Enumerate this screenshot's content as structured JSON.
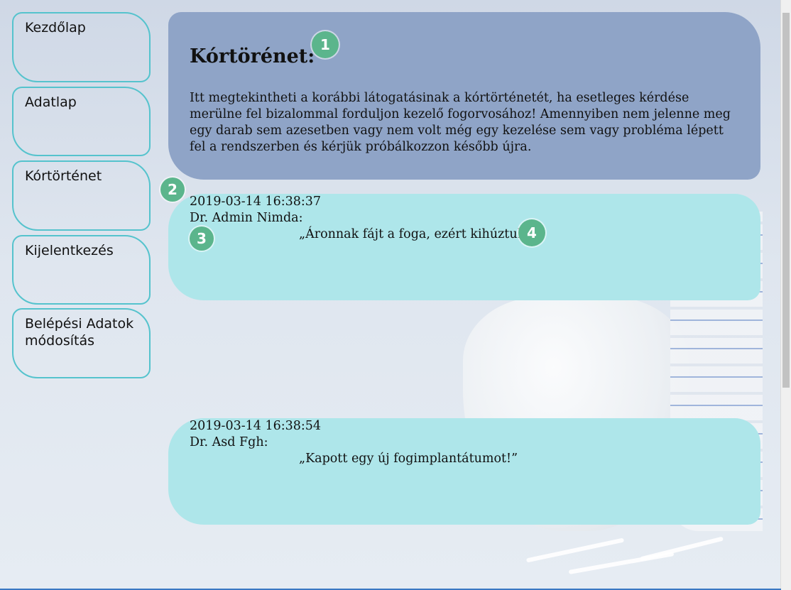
{
  "sidebar": {
    "items": [
      {
        "label": "Kezdőlap"
      },
      {
        "label": "Adatlap"
      },
      {
        "label": "Kórtörténet"
      },
      {
        "label": "Kijelentkezés"
      },
      {
        "label": "Belépési Adatok módosítás"
      }
    ]
  },
  "header": {
    "title": "Kórtörénet:",
    "text": "Itt megtekintheti a korábbi látogatásinak a kórtörténetét, ha esetleges kérdése merülne fel bizalommal forduljon kezelő fogorvosához! Amennyiben nem jelenne meg egy darab sem azesetben vagy nem volt még egy kezelése sem vagy probléma lépett fel a rendszerben és kérjük próbálkozzon később újra."
  },
  "entries": [
    {
      "date": "2019-03-14 16:38:37",
      "doctor": "Dr. Admin Nimda:",
      "note": "„Áronnak fájt a foga, ezért kihúztuk.”"
    },
    {
      "date": "2019-03-14 16:38:54",
      "doctor": "Dr. Asd Fgh:",
      "note": "„Kapott egy új fogimplantátumot!”"
    }
  ],
  "markers": [
    "1",
    "2",
    "3",
    "4"
  ],
  "colors": {
    "header_panel": "#8fa4c7",
    "entry_panel": "#aee6ea",
    "nav_border": "#55c3cd",
    "marker": "#5bb58c"
  }
}
